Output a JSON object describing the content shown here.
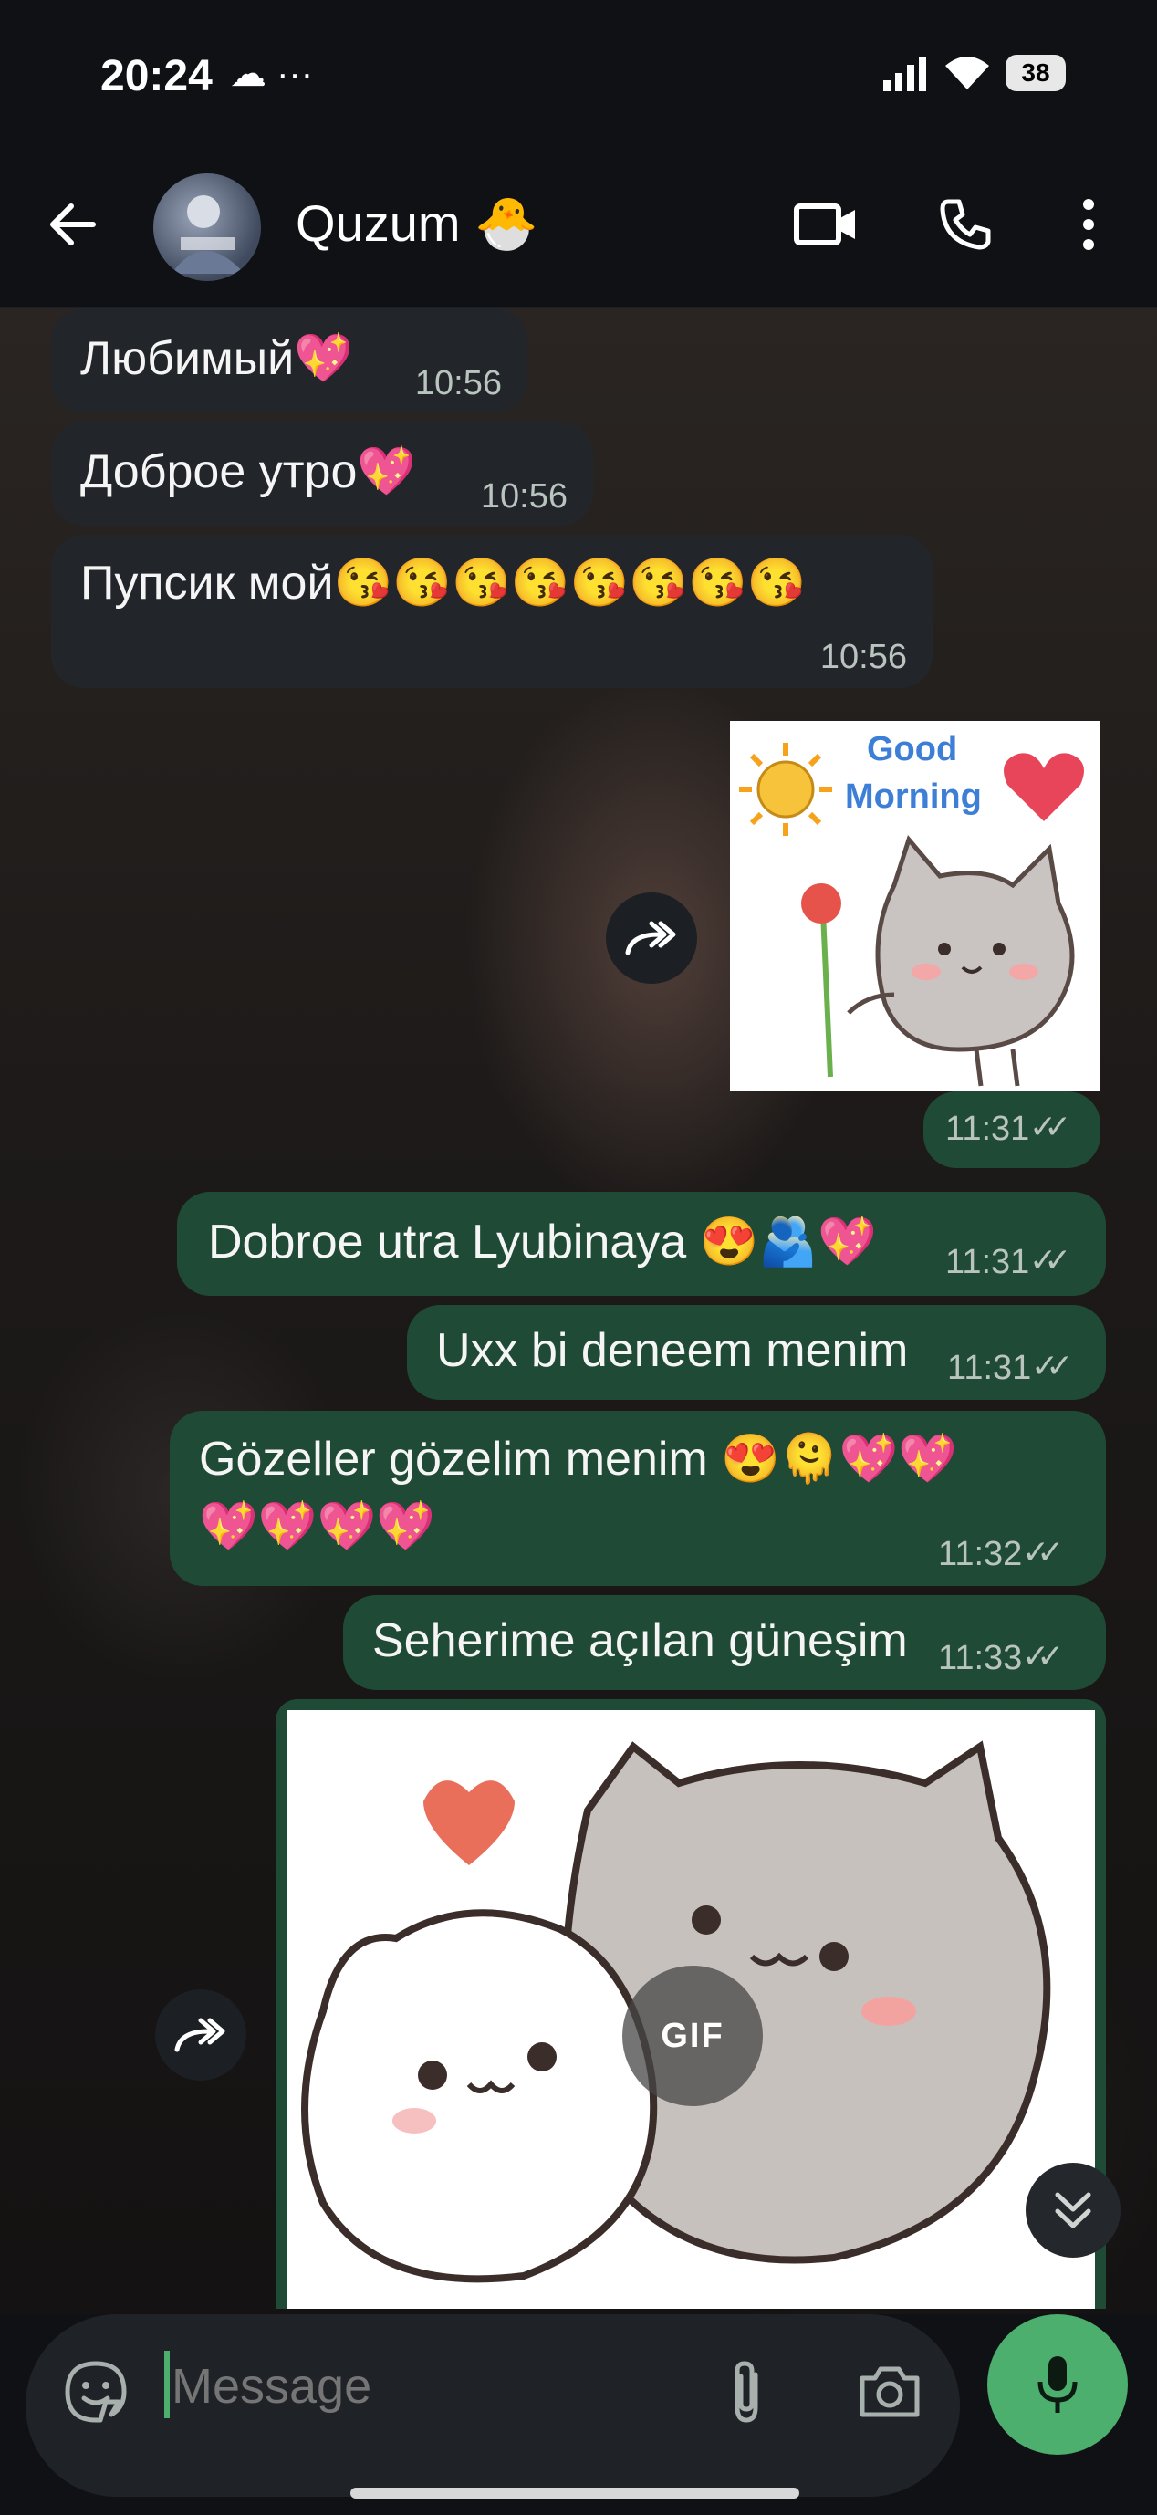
{
  "status_bar": {
    "time": "20:24",
    "extra": "☁ ···",
    "battery": "38"
  },
  "header": {
    "contact_name": "Quzum 🐣"
  },
  "messages": [
    {
      "text": "Любимый💖",
      "time": "10:56"
    },
    {
      "text": "Доброе утро💖",
      "time": "10:56"
    },
    {
      "text": "Пупсик мой😘😘😘😘😘😘😘😘",
      "time": "10:56"
    },
    {
      "sticker_text_1": "Good",
      "sticker_text_2": "Morning",
      "time": "11:31",
      "ticks": "✓✓"
    },
    {
      "text": "Dobroe utra Lyubinaya 😍🫂💖",
      "time": "11:31",
      "ticks": "✓✓"
    },
    {
      "text": "Uxx bi deneem menim",
      "time": "11:31",
      "ticks": "✓✓"
    },
    {
      "text_line_1": "Gözeller gözelim menim 😍🫠💖💖",
      "text_line_2": "💖💖💖💖",
      "time": "11:32",
      "ticks": "✓✓"
    },
    {
      "text": "Seherime açılan güneşim",
      "time": "11:33",
      "ticks": "✓✓"
    },
    {
      "gif_label": "GIF"
    }
  ],
  "composer": {
    "placeholder": "Message"
  },
  "colors": {
    "accent": "#4caf6d",
    "outgoing_bubble": "#1f4a36",
    "incoming_bubble": "#22262b"
  }
}
